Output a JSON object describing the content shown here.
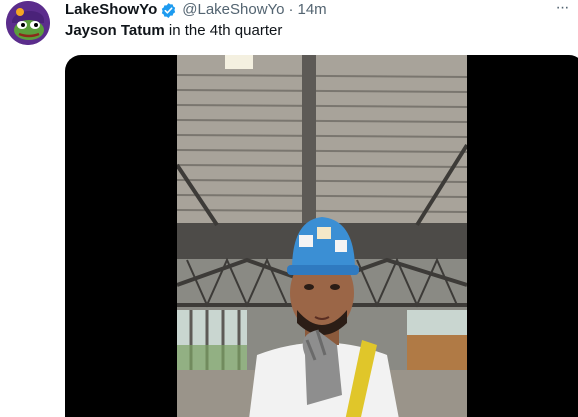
{
  "author": {
    "display_name": "LakeShowYo",
    "handle": "@LakeShowYo",
    "separator": "·",
    "timestamp": "14m",
    "verified": true
  },
  "tweet": {
    "text_bold": "Jayson Tatum",
    "text_rest": " in the 4th quarter"
  },
  "actions": {
    "more_label": "···"
  },
  "media": {
    "type": "video",
    "icon": "hard-hat-worker-video-frame"
  },
  "colors": {
    "verified_blue": "#1d9bf0",
    "text_primary": "#0f1419",
    "text_secondary": "#536471",
    "avatar_purple": "#5b2d8c"
  }
}
